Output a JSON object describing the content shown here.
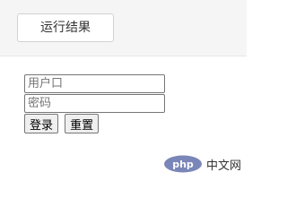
{
  "toolbar": {
    "tab_label": "运行结果"
  },
  "login_form": {
    "username_placeholder": "用户口",
    "username_value": "",
    "password_placeholder": "密码",
    "password_value": "",
    "login_label": "登录",
    "reset_label": "重置"
  },
  "watermark": {
    "logo_text": "php",
    "site_text": "中文网",
    "brand_color": "#7a86b8"
  }
}
